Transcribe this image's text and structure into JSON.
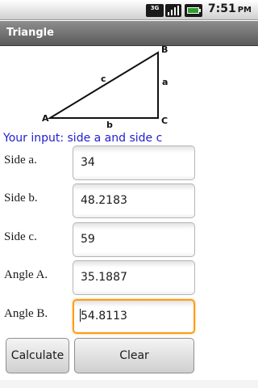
{
  "status_bar": {
    "network_label": "3G",
    "time": "7:51",
    "time_suffix": "PM",
    "icons": [
      "network-3g-icon",
      "signal-icon",
      "battery-icon"
    ]
  },
  "app": {
    "title": "Triangle"
  },
  "diagram": {
    "vertices": {
      "a": "A",
      "b": "B",
      "c": "C"
    },
    "sides": {
      "a": "a",
      "b": "b",
      "c": "c"
    }
  },
  "note": "Your input: side a and side c",
  "fields": [
    {
      "label": "Side a.",
      "value": "34"
    },
    {
      "label": "Side b.",
      "value": "48.2183"
    },
    {
      "label": "Side c.",
      "value": "59"
    },
    {
      "label": "Angle A.",
      "value": "35.1887"
    },
    {
      "label": "Angle B.",
      "value": "54.8113"
    }
  ],
  "buttons": {
    "calculate": "Calculate",
    "clear": "Clear"
  },
  "colors": {
    "note_text": "#1e1ed0",
    "focus_border": "#ff9d1a",
    "title_bar": "#6e6e6e"
  }
}
